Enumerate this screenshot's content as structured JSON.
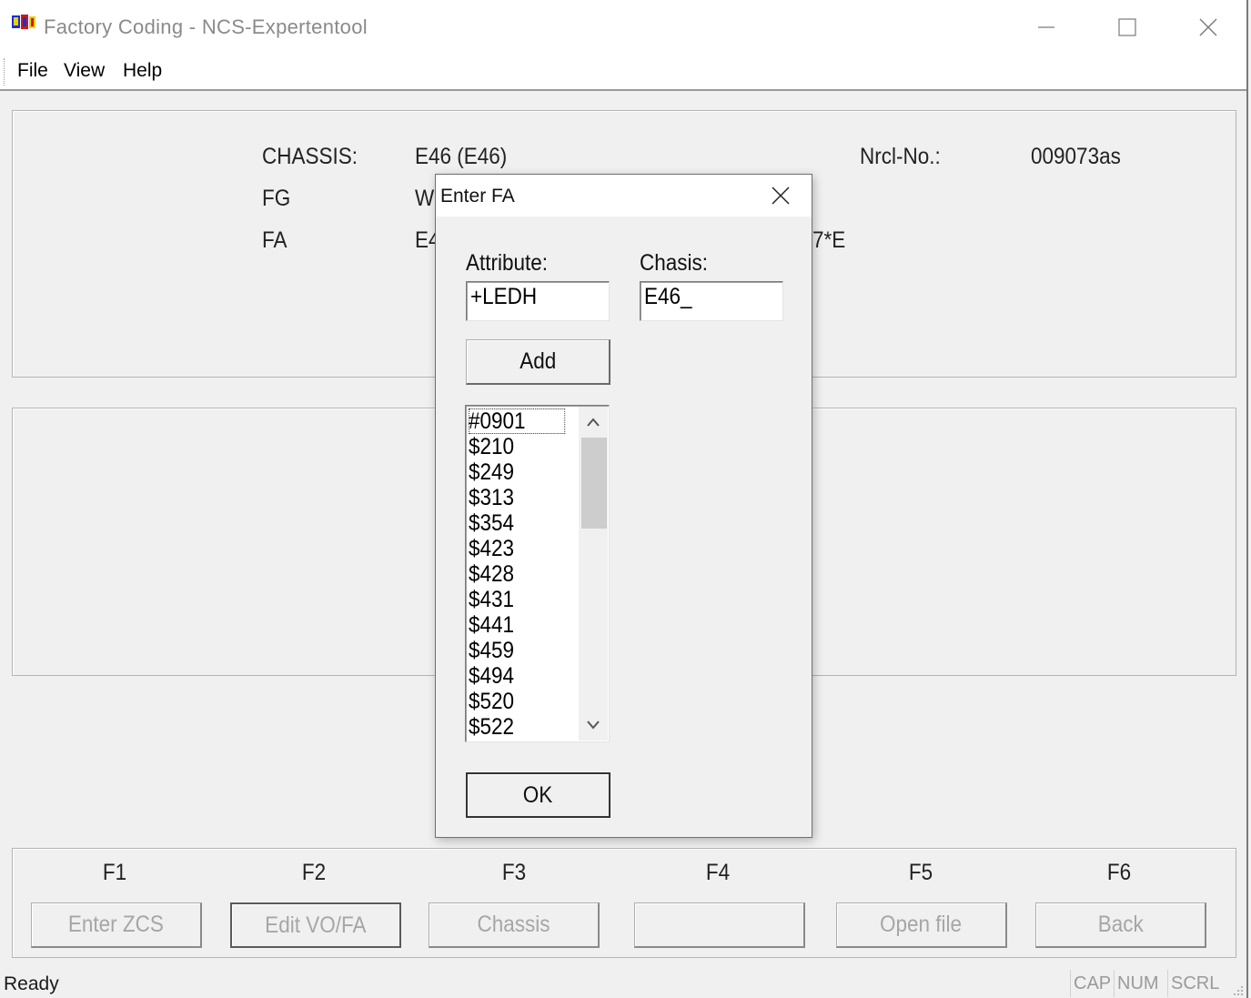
{
  "window": {
    "title": "Factory Coding - NCS-Expertentool"
  },
  "menu": {
    "items": [
      "File",
      "View",
      "Help"
    ]
  },
  "info_panel": {
    "chassis_label": "CHASSIS:",
    "chassis_value": "E46 (E46)",
    "fg_label": "FG",
    "fg_value_partial": "WE",
    "fa_label": "FA",
    "fa_value_partial": "E4",
    "fa_value_right_partial": "7*E",
    "nrcl_label": "Nrcl-No.:",
    "nrcl_value": "009073as"
  },
  "function_keys": [
    {
      "key": "F1",
      "label": "Enter ZCS"
    },
    {
      "key": "F2",
      "label": "Edit VO/FA"
    },
    {
      "key": "F3",
      "label": "Chassis"
    },
    {
      "key": "F4",
      "label": ""
    },
    {
      "key": "F5",
      "label": "Open file"
    },
    {
      "key": "F6",
      "label": "Back"
    }
  ],
  "status_bar": {
    "text": "Ready",
    "indicators": [
      "CAP",
      "NUM",
      "SCRL"
    ]
  },
  "dialog": {
    "title": "Enter FA",
    "attribute_label": "Attribute:",
    "attribute_value": "+LEDH",
    "chassis_label": "Chasis:",
    "chassis_value": "E46_",
    "add_label": "Add",
    "ok_label": "OK",
    "list_items": [
      "#0901",
      "$210",
      "$249",
      "$313",
      "$354",
      "$423",
      "$428",
      "$431",
      "$441",
      "$459",
      "$494",
      "$520",
      "$522"
    ]
  },
  "colors": {
    "window_bg": "#f0f0f0",
    "titlebar_bg": "#ffffff",
    "disabled_text": "#a6a6a6"
  }
}
